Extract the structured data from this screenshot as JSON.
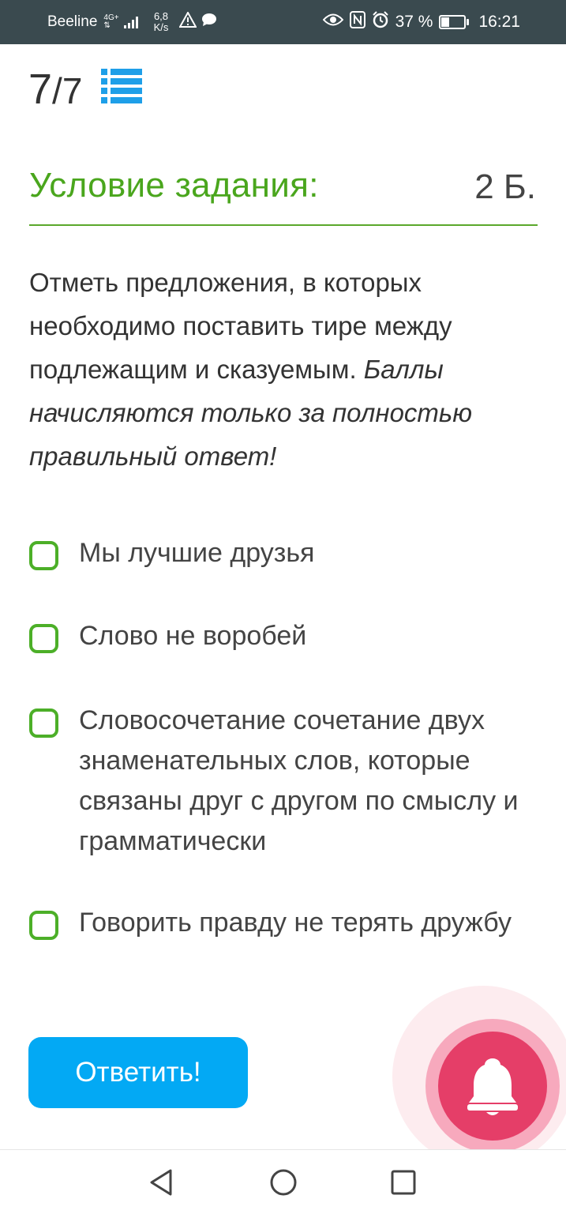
{
  "status_bar": {
    "carrier": "Beeline",
    "network": "4G+",
    "speed_value": "6,8",
    "speed_unit": "K/s",
    "battery_percent": "37 %",
    "battery_level": 0.37,
    "time": "16:21",
    "icons": [
      "warning-icon",
      "message-icon",
      "eye-icon",
      "nfc-icon",
      "alarm-icon"
    ]
  },
  "header": {
    "question_current": "7",
    "question_total": "/7",
    "list_icon": "list-icon"
  },
  "task": {
    "title": "Условие задания:",
    "points": "2 Б.",
    "question_plain": "Отметь предложения, в которых необходимо поставить тире между подлежащим и сказуемым. ",
    "question_italic": "Баллы начисляются только за полностью правильный ответ!"
  },
  "options": [
    {
      "label": "Мы лучшие друзья",
      "checked": false
    },
    {
      "label": "Слово не воробей",
      "checked": false
    },
    {
      "label": "Словосочетание сочетание двух знаменательных слов, которые связаны друг с другом по смыслу и грамматически",
      "checked": false
    },
    {
      "label": "Говорить правду не терять дружбу",
      "checked": false
    }
  ],
  "answer_button": {
    "label": "Ответить!"
  },
  "colors": {
    "accent_green": "#4aa61d",
    "button_blue": "#03a9f4",
    "bell_pink": "#e53e68",
    "status_bar": "#3a4a4f"
  },
  "floating": {
    "icon": "bell-icon"
  },
  "navbar": {
    "icons": [
      "back-icon",
      "home-icon",
      "recents-icon"
    ]
  }
}
